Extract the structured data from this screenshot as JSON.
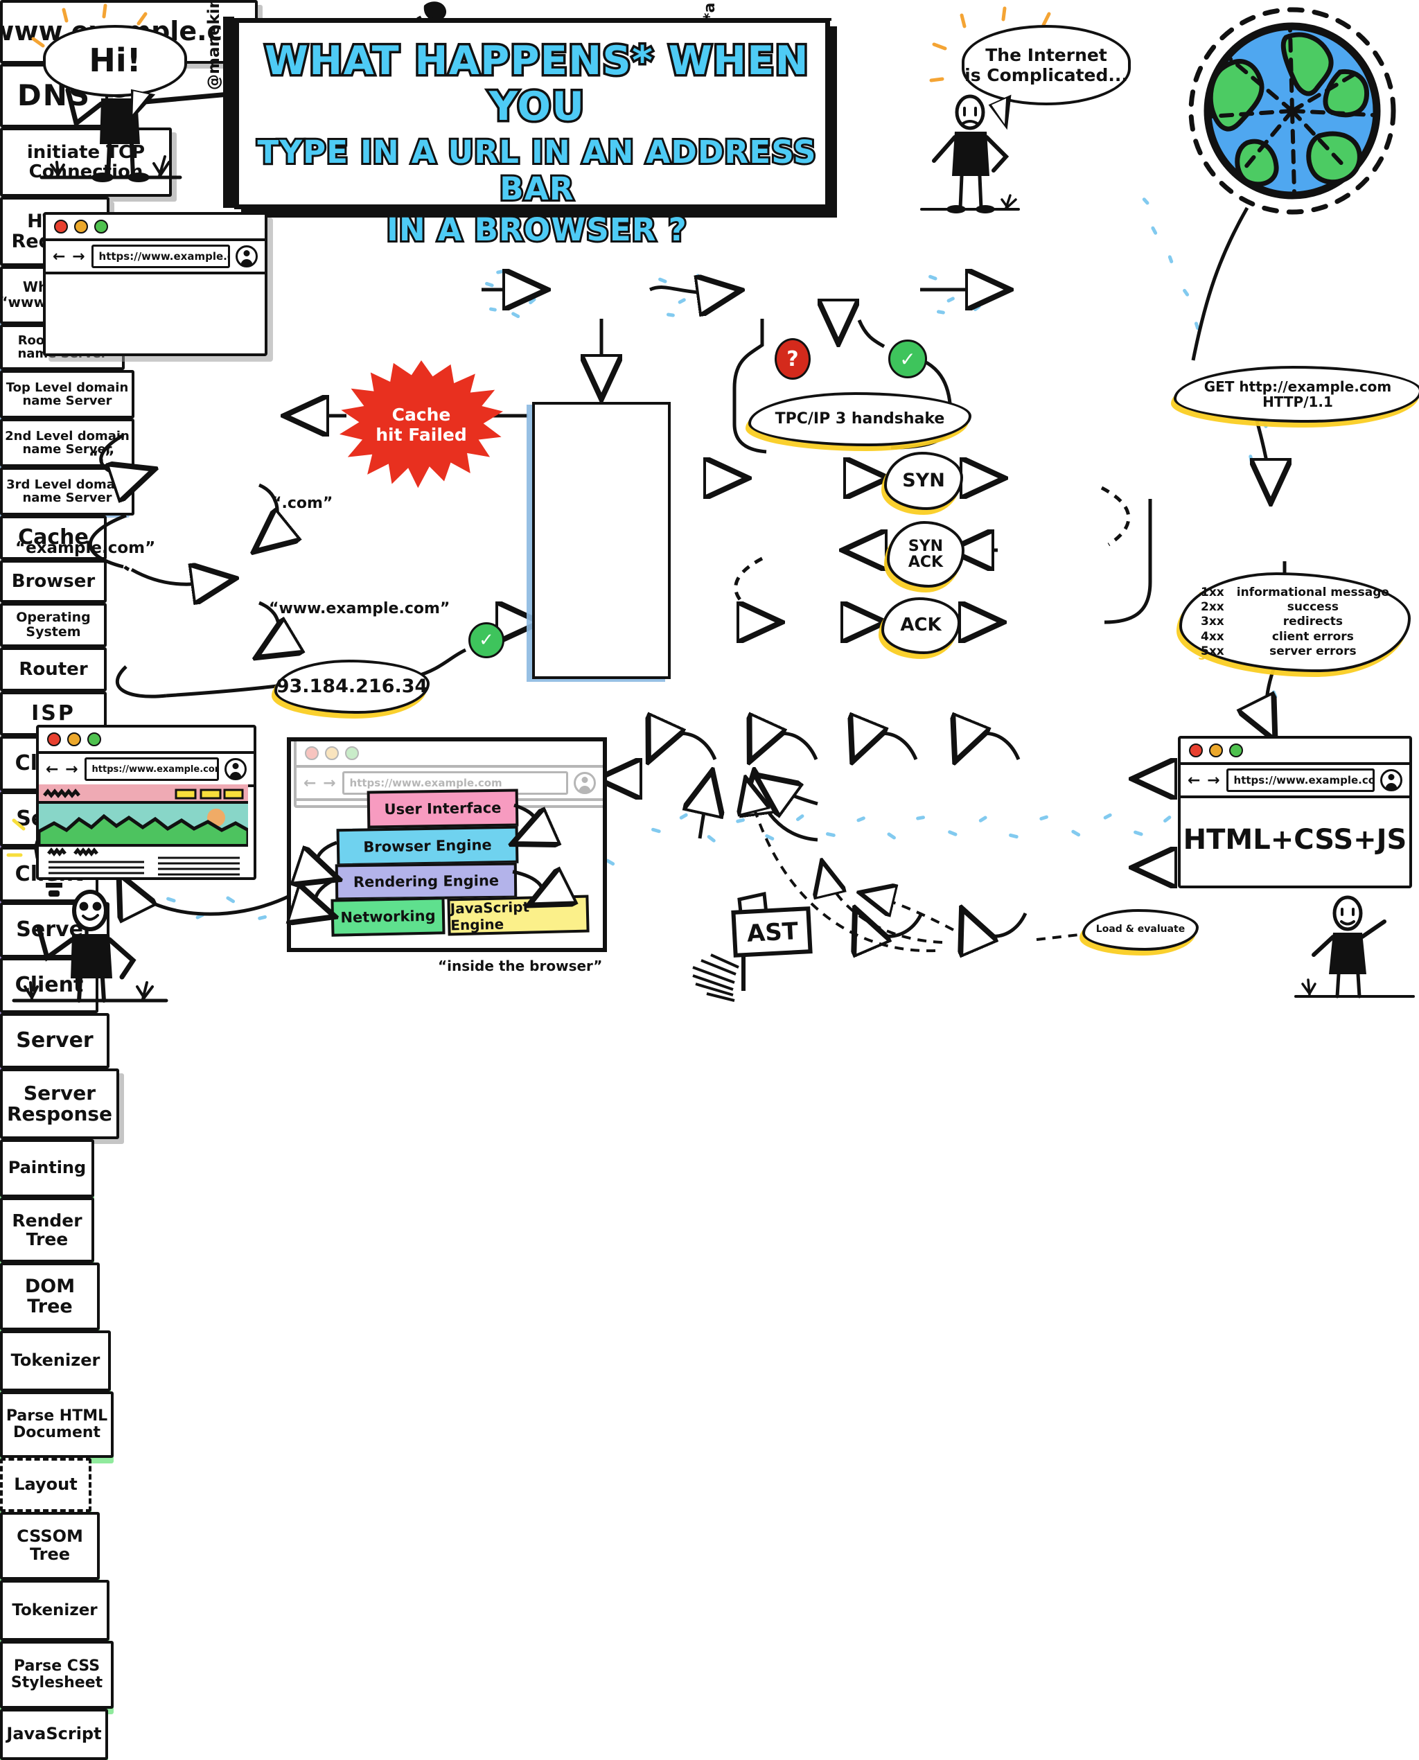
{
  "meta": {
    "title_lines": [
      "WHAT HAPPENS* WHEN YOU",
      "TYPE IN A URL IN AN ADDRESS BAR",
      "IN A BROWSER ?"
    ],
    "footnote": "*a brief overview",
    "author": "@manekinekko",
    "accent_title": "#4ecbf5"
  },
  "characters": {
    "greeting_bubble": "Hi!",
    "internet_bubble": "The Internet\nis Complicated..."
  },
  "flow_top": {
    "url_box": "www.example.com",
    "dns": "DNS",
    "tcp": "initiate TCP\nConnection",
    "http_request": "HTTP\nRequest"
  },
  "browser_window_url": "https://www.example.com",
  "dns_lookup": {
    "question": "What's the IP of\n“www.example.com”?",
    "servers": [
      "Root domain\nname Server",
      "Top Level domain\nname Server",
      "2nd Level domain\nname Server",
      "3rd Level domain\nname Server"
    ],
    "server_labels": [
      "Root",
      "Top Level",
      "2",
      "3"
    ],
    "queries": [
      "“.”",
      "“.com”",
      "“example.com”",
      "“www.example.com”"
    ],
    "resolved_ip": "93.184.216.34"
  },
  "cache": {
    "burst_text": "Cache\nhit Failed",
    "burst_color": "#e8301f",
    "header": "Cache",
    "levels": [
      "Browser",
      "Operating\nSystem",
      "Router",
      "ISP"
    ]
  },
  "tcp_handshake": {
    "cloud_label": "TPC/IP 3 handshake",
    "question_badge": "?",
    "question_color": "#d42a1c",
    "ok_badge": "✓",
    "ok_color": "#3ec45c",
    "rows": [
      {
        "left": "Client",
        "packet": "SYN",
        "right": "Server"
      },
      {
        "left": "Client",
        "packet": "SYN\nACK",
        "right": "Server"
      },
      {
        "left": "Client",
        "packet": "ACK",
        "right": "Server"
      }
    ]
  },
  "server_side": {
    "get_request": "GET http://example.com HTTP/1.1",
    "server_response": "Server\nResponse",
    "status_codes": [
      {
        "code": "1xx",
        "meaning": "informational message"
      },
      {
        "code": "2xx",
        "meaning": "success"
      },
      {
        "code": "3xx",
        "meaning": "redirects"
      },
      {
        "code": "4xx",
        "meaning": "client errors"
      },
      {
        "code": "5xx",
        "meaning": "server errors"
      }
    ],
    "payload": "HTML+CSS+JS"
  },
  "render_pipeline": {
    "row_html": [
      "Painting",
      "Render\nTree",
      "DOM\nTree",
      "Tokenizer",
      "Parse HTML\nDocument"
    ],
    "row_css": [
      "CSSOM\nTree",
      "Tokenizer",
      "Parse CSS\nStylesheet"
    ],
    "layout": "Layout",
    "ast_sign": "AST",
    "javascript": "JavaScript",
    "load_evaluate": "Load & evaluate"
  },
  "inside_browser": {
    "caption": "“inside the browser”",
    "ghost_url": "https://www.example.com",
    "components": [
      {
        "label": "User Interface",
        "color": "#f79bc0"
      },
      {
        "label": "Browser Engine",
        "color": "#6fd2ef"
      },
      {
        "label": "Rendering Engine",
        "color": "#b3b3ea"
      },
      {
        "label": "Networking",
        "color": "#5fe08e"
      },
      {
        "label": "JavaScript Engine",
        "color": "#fbf08a"
      }
    ]
  }
}
